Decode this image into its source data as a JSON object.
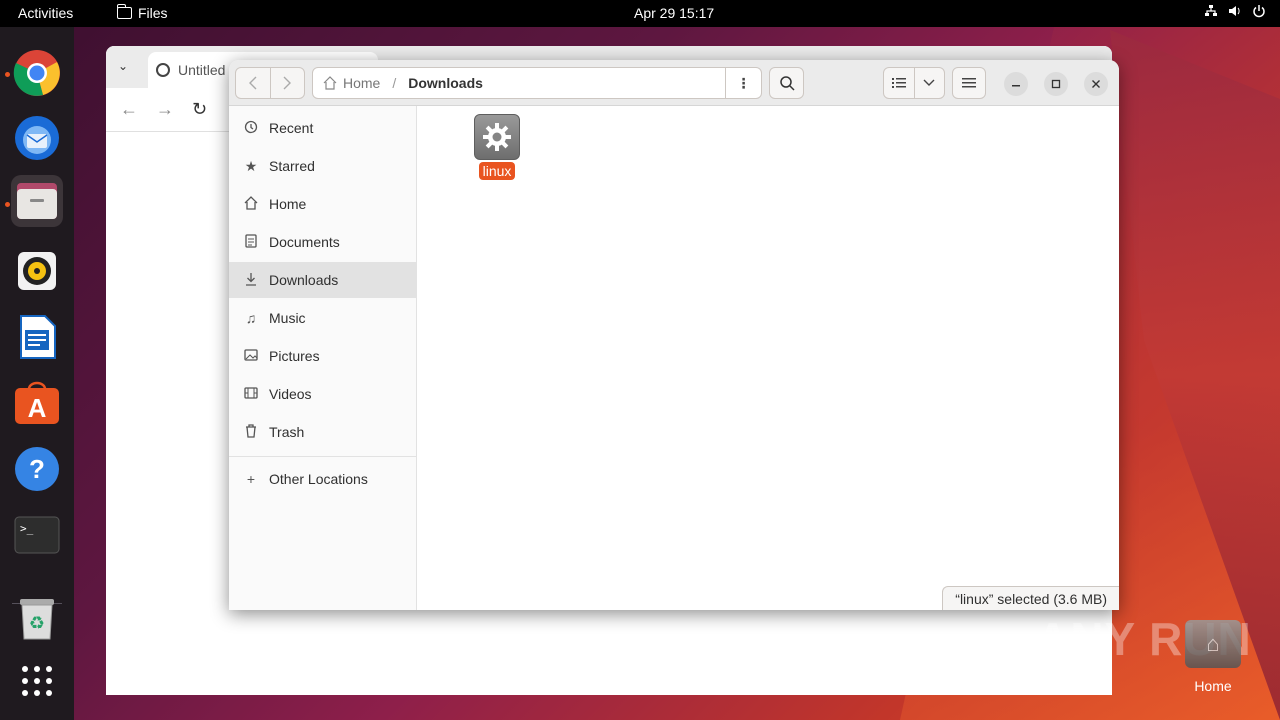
{
  "topbar": {
    "activities": "Activities",
    "app_name": "Files",
    "clock": "Apr 29  15:17"
  },
  "dock": {
    "items": [
      "chrome-icon",
      "thunderbird-icon",
      "files-icon",
      "rhythmbox-icon",
      "libreoffice-writer-icon",
      "app-center-icon",
      "help-icon",
      "terminal-icon",
      "trash-icon",
      "show-apps-icon"
    ]
  },
  "browser": {
    "tab_title": "Untitled"
  },
  "files": {
    "path_home": "Home",
    "path_current": "Downloads",
    "sidebar": [
      {
        "label": "Recent",
        "icon": "clock-icon"
      },
      {
        "label": "Starred",
        "icon": "star-icon"
      },
      {
        "label": "Home",
        "icon": "home-icon"
      },
      {
        "label": "Documents",
        "icon": "document-icon"
      },
      {
        "label": "Downloads",
        "icon": "download-icon",
        "active": true
      },
      {
        "label": "Music",
        "icon": "music-icon"
      },
      {
        "label": "Pictures",
        "icon": "picture-icon"
      },
      {
        "label": "Videos",
        "icon": "video-icon"
      },
      {
        "label": "Trash",
        "icon": "trash-icon"
      }
    ],
    "other_locations": "Other Locations",
    "file": {
      "name": "linux",
      "icon": "executable-gear-icon"
    },
    "status": "“linux” selected  (3.6 MB)"
  },
  "desktop": {
    "home_label": "Home",
    "watermark": "ANY RUN"
  },
  "colors": {
    "accent": "#e95420",
    "topbar": "#000000",
    "dock": "#1f1a1f"
  }
}
